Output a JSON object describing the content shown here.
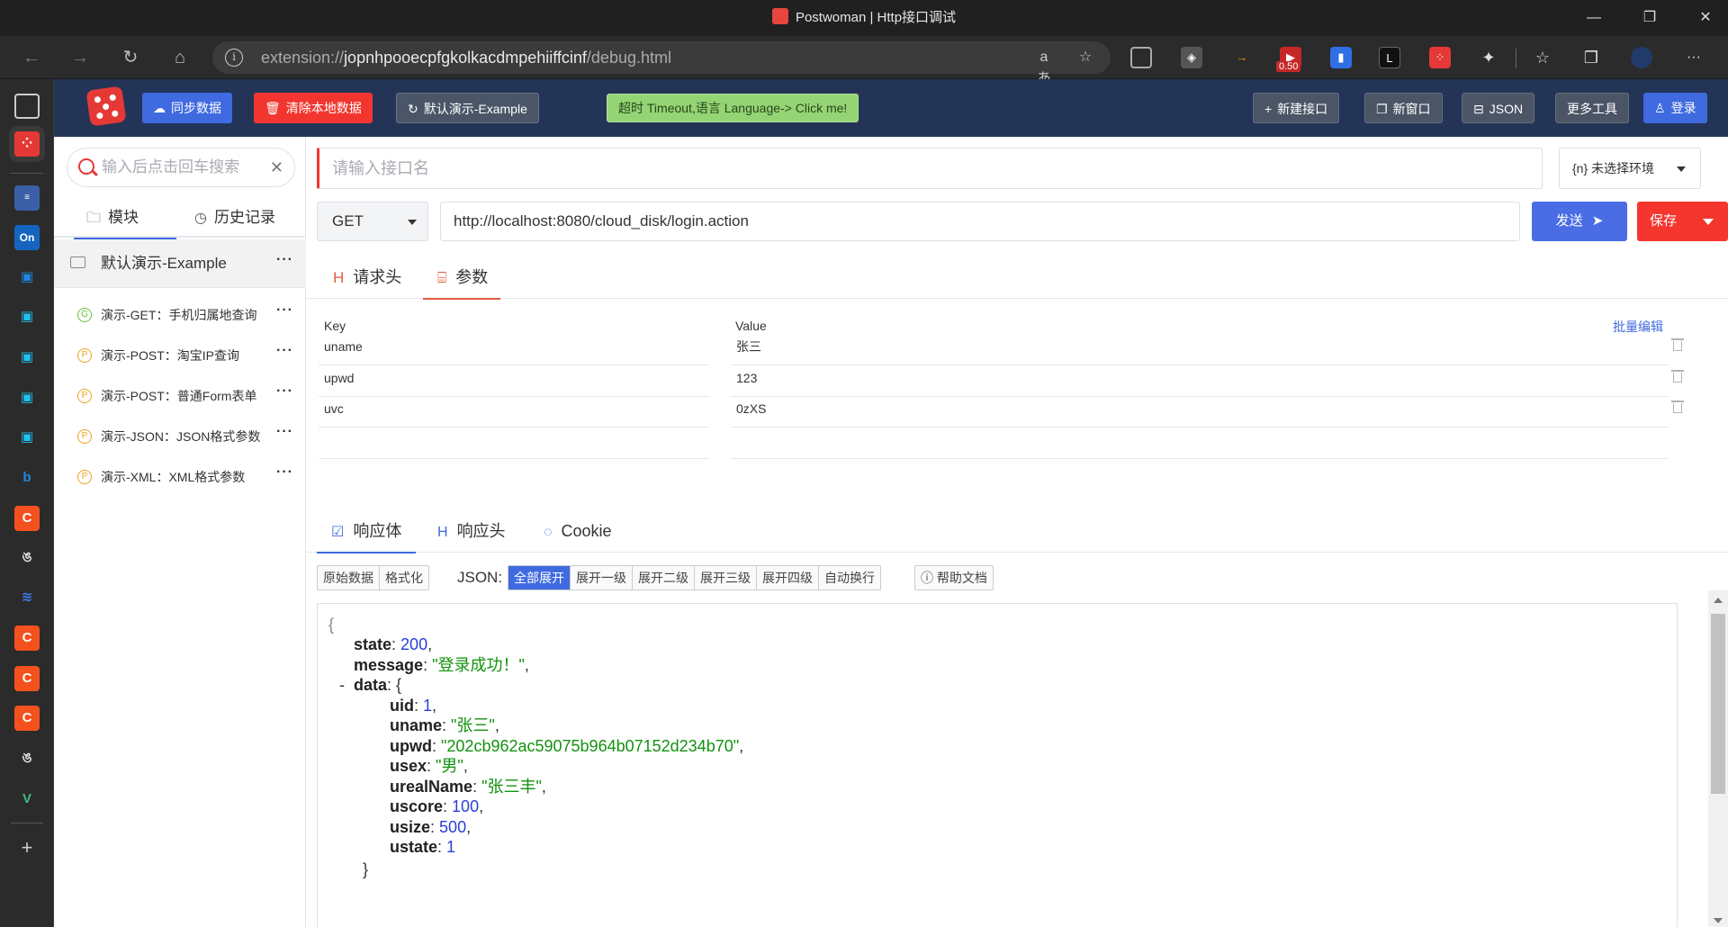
{
  "window": {
    "title": "Postwoman | Http接口调试",
    "minimize": "—",
    "maximize": "❐",
    "close": "✕"
  },
  "browser": {
    "url_prefix": "extension://",
    "url_host": "jopnhpooecpfgkolkacdmpehiiffcinf",
    "url_path": "/debug.html",
    "ext_badge": "0.50",
    "read_aloud": "aあ",
    "fav_icon": "☆",
    "more": "···"
  },
  "app_header": {
    "sync_label": "同步数据",
    "clear_local_label": "清除本地数据",
    "demo_label": "默认演示-Example",
    "timeout_label": "超时 Timeout,语言 Language-> Click me!",
    "new_api_label": "新建接口",
    "new_window_label": "新窗口",
    "json_label": "JSON",
    "more_tools_label": "更多工具",
    "login_label": "登录"
  },
  "sidebar": {
    "search_placeholder": "输入后点击回车搜索",
    "tab_modules": "模块",
    "tab_history": "历史记录",
    "folder_name": "默认演示-Example",
    "more": "···",
    "apis": [
      {
        "badge": "G",
        "kind": "g",
        "label": "演示-GET：手机归属地查询"
      },
      {
        "badge": "P",
        "kind": "p",
        "label": "演示-POST：淘宝IP查询"
      },
      {
        "badge": "P",
        "kind": "p",
        "label": "演示-POST：普通Form表单"
      },
      {
        "badge": "P",
        "kind": "p",
        "label": "演示-JSON：JSON格式参数"
      },
      {
        "badge": "P",
        "kind": "p",
        "label": "演示-XML：XML格式参数"
      }
    ]
  },
  "request": {
    "name_placeholder": "请输入接口名",
    "env_label": "{n} 未选择环境",
    "method": "GET",
    "url": "http://localhost:8080/cloud_disk/login.action",
    "send_label": "发送",
    "save_label": "保存",
    "tab_headers": "请求头",
    "tab_params": "参数"
  },
  "params": {
    "key_header": "Key",
    "value_header": "Value",
    "batch_edit": "批量编辑",
    "rows": [
      {
        "key": "uname",
        "value": "张三"
      },
      {
        "key": "upwd",
        "value": "123"
      },
      {
        "key": "uvc",
        "value": "0zXS"
      },
      {
        "key": "",
        "value": ""
      }
    ]
  },
  "response": {
    "tab_body": "响应体",
    "tab_headers": "响应头",
    "tab_cookie": "Cookie",
    "view_buttons": [
      "原始数据",
      "格式化"
    ],
    "json_label": "JSON:",
    "expand_buttons": [
      "全部展开",
      "展开一级",
      "展开二级",
      "展开三级",
      "展开四级",
      "自动换行"
    ],
    "help_label": "帮助文档",
    "body": {
      "open_brace": "{",
      "state_key": "state",
      "state": "200",
      "message_key": "message",
      "message": "\"登录成功！\"",
      "collapse": "-",
      "data_key": "data",
      "uid_key": "uid",
      "uid": "1",
      "uname_key": "uname",
      "uname": "\"张三\"",
      "upwd_key": "upwd",
      "upwd": "\"202cb962ac59075b964b07152d234b70\"",
      "usex_key": "usex",
      "usex": "\"男\"",
      "urealName_key": "urealName",
      "urealName": "\"张三丰\"",
      "uscore_key": "uscore",
      "uscore": "100",
      "usize_key": "usize",
      "usize": "500",
      "ustate_key": "ustate",
      "ustate": "1",
      "close_brace": "}"
    }
  }
}
